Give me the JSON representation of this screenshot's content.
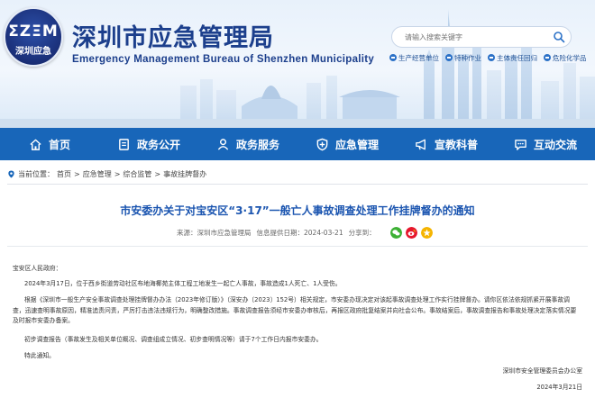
{
  "header": {
    "logo_mark": "ΣΖΞΜ",
    "logo_text": "深圳应急",
    "title": "深圳市应急管理局",
    "subtitle": "Emergency Management Bureau of Shenzhen Municipality",
    "search_placeholder": "请输入搜索关键字",
    "quick_links": [
      "生产经营单位",
      "特种作业",
      "主体责任回归",
      "危险化学品"
    ]
  },
  "nav": {
    "items": [
      {
        "label": "首页",
        "icon": "home-icon"
      },
      {
        "label": "政务公开",
        "icon": "document-icon"
      },
      {
        "label": "政务服务",
        "icon": "service-icon"
      },
      {
        "label": "应急管理",
        "icon": "shield-icon"
      },
      {
        "label": "宣教科普",
        "icon": "megaphone-icon"
      },
      {
        "label": "互动交流",
        "icon": "chat-icon"
      }
    ],
    "active_color": "#1866b9"
  },
  "breadcrumb": {
    "prefix": "当前位置：",
    "items": [
      "首页",
      "应急管理",
      "综合监管",
      "事故挂牌督办"
    ],
    "separator": ">"
  },
  "article": {
    "title": "市安委办关于对宝安区“3·17”一般亡人事故调查处理工作挂牌督办的通知",
    "source": "来源：深圳市应急管理局",
    "date": "信息提供日期：2024-03-21",
    "share_label": "分享到：",
    "salutation": "宝安区人民政府：",
    "paragraphs": [
      "2024年3月17日，位于西乡街道劳动社区布地海椰苑主体工程工地发生一起亡人事故，事故造成1人死亡、1人受伤。",
      "根据《深圳市一般生产安全事故调查处理挂牌督办办法（2023年修订版）》（深安办〔2023〕152号）相关规定，市安委办现决定对该起事故调查处理工作实行挂牌督办。请你区依法依规抓紧开展事故调查，迅速查明事故原因，精准追责问责，严厉打击违法违规行为，明确整改措施。事故调查报告须经市安委办审核后，再报区政府批复结案并向社会公布。事故结案后，事故调查报告和事故处理决定落实情况要及时报市安委办备案。",
      "初步调查报告（事故发生及相关单位概况、调查组成立情况、初步查明情况等）请于7个工作日内报市安委办。",
      "特此通知。"
    ],
    "signature": "深圳市安全管理委员会办公室",
    "sign_date": "2024年3月21日"
  },
  "colors": {
    "brand": "#1c3f8c",
    "nav": "#1866b9",
    "title": "#1b55b0"
  }
}
